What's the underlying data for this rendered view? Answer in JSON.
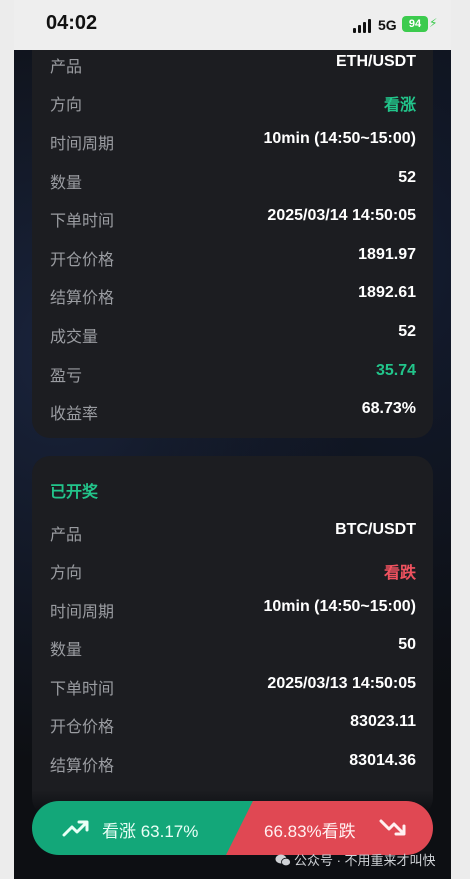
{
  "status_bar": {
    "time": "04:02",
    "network": "5G",
    "battery": "94"
  },
  "order1": {
    "rows": [
      {
        "label": "产品",
        "value": "ETH/USDT",
        "tone": "white"
      },
      {
        "label": "方向",
        "value": "看涨",
        "tone": "green"
      },
      {
        "label": "时间周期",
        "value": "10min (14:50~15:00)",
        "tone": "white"
      },
      {
        "label": "数量",
        "value": "52",
        "tone": "white"
      },
      {
        "label": "下单时间",
        "value": "2025/03/14 14:50:05",
        "tone": "white"
      },
      {
        "label": "开仓价格",
        "value": "1891.97",
        "tone": "white"
      },
      {
        "label": "结算价格",
        "value": "1892.61",
        "tone": "white"
      },
      {
        "label": "成交量",
        "value": "52",
        "tone": "white"
      },
      {
        "label": "盈亏",
        "value": "35.74",
        "tone": "green"
      },
      {
        "label": "收益率",
        "value": "68.73%",
        "tone": "white"
      }
    ]
  },
  "order2": {
    "status": "已开奖",
    "rows": [
      {
        "label": "产品",
        "value": "BTC/USDT",
        "tone": "white"
      },
      {
        "label": "方向",
        "value": "看跌",
        "tone": "red"
      },
      {
        "label": "时间周期",
        "value": "10min (14:50~15:00)",
        "tone": "white"
      },
      {
        "label": "数量",
        "value": "50",
        "tone": "white"
      },
      {
        "label": "下单时间",
        "value": "2025/03/13 14:50:05",
        "tone": "white"
      },
      {
        "label": "开仓价格",
        "value": "83023.11",
        "tone": "white"
      },
      {
        "label": "结算价格",
        "value": "83014.36",
        "tone": "white"
      }
    ]
  },
  "actions": {
    "up_label": "看涨 63.17%",
    "down_label": "66.83%看跌"
  },
  "watermark": "公众号 · 不用重来才叫快",
  "colors": {
    "green": "#22c58b",
    "red": "#f0525f",
    "card": "#1c1d21",
    "background": "#0d0f13"
  },
  "icons": [
    "signal-icon",
    "battery-icon",
    "trend-up-icon",
    "trend-down-icon",
    "wechat-icon"
  ]
}
